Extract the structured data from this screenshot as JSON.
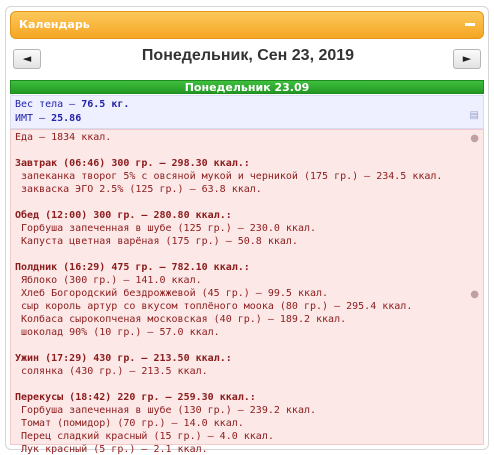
{
  "widget": {
    "title": "Календарь"
  },
  "nav": {
    "prev": "◄",
    "next": "►",
    "date": "Понедельник, Сен 23, 2019"
  },
  "day": {
    "header": "Понедельник 23.09"
  },
  "body": {
    "weight_label": "Вес тела — ",
    "weight_value": "76.5 кг.",
    "bmi_label": "ИМТ — ",
    "bmi_value": "25.86"
  },
  "food": {
    "total": "Еда — 1834 ккал.",
    "meals": [
      {
        "title": "Завтрак (06:46) 300 гр. — 298.30 ккал.:",
        "items": [
          "запеканка творог 5% с овсяной мукой и черникой (175 гр.) — 234.5 ккал.",
          "закваска ЭГО 2.5% (125 гр.) — 63.8 ккал."
        ]
      },
      {
        "title": "Обед (12:00) 300 гр. — 280.80 ккал.:",
        "items": [
          "Горбуша запеченная в шубе (125 гр.) — 230.0 ккал.",
          "Капуста цветная варёная (175 гр.) — 50.8 ккал."
        ]
      },
      {
        "title": "Полдник (16:29) 475 гр. — 782.10 ккал.:",
        "items": [
          "Яблоко (300 гр.) — 141.0 ккал.",
          "Хлеб Богородский бездрожжевой (45 гр.) — 99.5 ккал.",
          "сыр король артур со вкусом топлёного моока (80 гр.) — 295.4 ккал.",
          "Колбаса сырокопченая московская (40 гр.) — 189.2 ккал.",
          "шоколад 90% (10 гр.) — 57.0 ккал."
        ]
      },
      {
        "title": "Ужин (17:29) 430 гр. — 213.50 ккал.:",
        "items": [
          "солянка (430 гр.) — 213.5 ккал."
        ]
      },
      {
        "title": "Перекусы (18:42) 220 гр. — 259.30 ккал.:",
        "items": [
          "Горбуша запеченная в шубе (130 гр.) — 239.2 ккал.",
          "Томат (помидор) (70 гр.) — 14.0 ккал.",
          "Перец сладкий красный (15 гр.) — 4.0 ккал.",
          "Лук красный (5 гр.) — 2.1 ккал."
        ]
      }
    ]
  }
}
